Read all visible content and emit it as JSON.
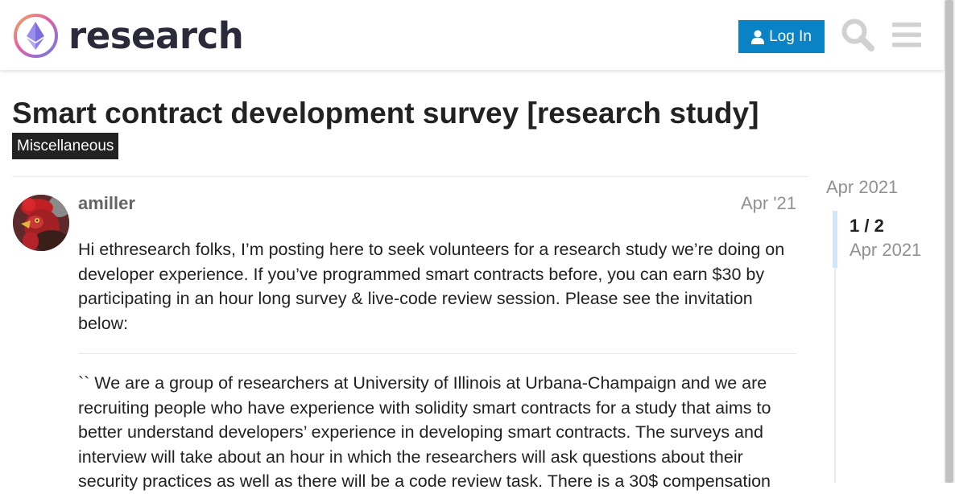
{
  "header": {
    "logo_text": "research",
    "login_label": "Log In",
    "search_icon": "search-icon",
    "menu_icon": "hamburger-menu-icon",
    "accent_color": "#0a82c6"
  },
  "topic": {
    "title": "Smart contract development survey [research study]",
    "category": "Miscellaneous"
  },
  "post": {
    "username": "amiller",
    "date": "Apr '21",
    "paragraph_1": "Hi ethresearch folks, I’m posting here to seek volunteers for a research study we’re doing on developer experience. If you’ve programmed smart contracts before, you can earn $30 by participating in an hour long survey & live-code review session. Please see the invitation below:",
    "paragraph_2": "`` We are a group of researchers at University of Illinois at Urbana-Champaign and we are recruiting people who have experience with solidity smart contracts for a study that aims to better understand developers’ experience in developing smart contracts. The surveys and interview will take about an hour in which the researchers will ask questions about their security practices as well as there will be a code review task. There is a 30$ compensation"
  },
  "timeline": {
    "top_date": "Apr 2021",
    "count": "1 / 2",
    "date": "Apr 2021"
  }
}
